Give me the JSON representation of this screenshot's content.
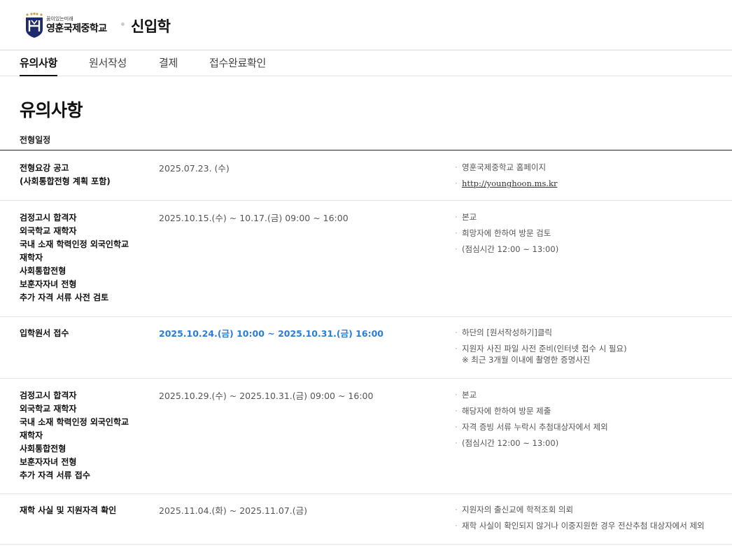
{
  "header": {
    "slogan": "꿈이있는미래",
    "school_name": "영훈국제중학교",
    "site_title": "신입학"
  },
  "tabs": [
    {
      "label": "유의사항",
      "active": true
    },
    {
      "label": "원서작성",
      "active": false
    },
    {
      "label": "결제",
      "active": false
    },
    {
      "label": "접수완료확인",
      "active": false
    }
  ],
  "page": {
    "heading": "유의사항",
    "section_label": "전형일정"
  },
  "schedule": [
    {
      "title": [
        "전형요강 공고",
        "(사회통합전형 계획 포함)"
      ],
      "date": "2025.07.23. (수)",
      "notes": [
        "영훈국제중학교 홈페이지",
        "http://younghoon.ms.kr"
      ]
    },
    {
      "title": [
        "검정고시 합격자",
        "외국학교 재학자",
        "국내 소재 학력인정 외국인학교",
        "재학자",
        "사회통합전형",
        "보훈자자녀 전형",
        "추가 자격 서류 사전 검토"
      ],
      "date": "2025.10.15.(수) ~ 10.17.(금) 09:00 ~ 16:00",
      "notes": [
        "본교",
        "희망자에 한하여 방문 검토",
        "(점심시간 12:00 ~ 13:00)"
      ]
    },
    {
      "title": [
        "입학원서 접수"
      ],
      "date": "2025.10.24.(금) 10:00 ~ 2025.10.31.(금) 16:00",
      "notes": [
        "하단의 [원서작성하기]클릭",
        "지원자 사진 파일 사전 준비(인터넷 접수 시 필요)",
        "※ 최근 3개월 이내에 촬영한 증명사진"
      ]
    },
    {
      "title": [
        "검정고시 합격자",
        "외국학교 재학자",
        "국내 소재 학력인정 외국인학교",
        "재학자",
        "사회통합전형",
        "보훈자자녀 전형",
        "추가 자격 서류 접수"
      ],
      "date": "2025.10.29.(수) ~ 2025.10.31.(금) 09:00 ~ 16:00",
      "notes": [
        "본교",
        "해당자에 한하여 방문 제출",
        "자격 증빙 서류 누락시 추첨대상자에서 제외",
        "(점심시간 12:00 ~ 13:00)"
      ]
    },
    {
      "title": [
        "재학 사실 및 지원자격 확인"
      ],
      "date": "2025.11.04.(화) ~ 2025.11.07.(금)",
      "notes": [
        "지원자의 출신교에 학적조회 의뢰",
        "재학 사실이 확인되지 않거나 이중지원한 경우 전산추첨 대상자에서 제외"
      ]
    }
  ],
  "colors": {
    "highlight": "#2a7dd6",
    "emblem": "#1e2a6e",
    "star": "#c9a14a"
  },
  "icons": {
    "logo": "school-emblem-icon",
    "bullet": "dot-bullet"
  }
}
